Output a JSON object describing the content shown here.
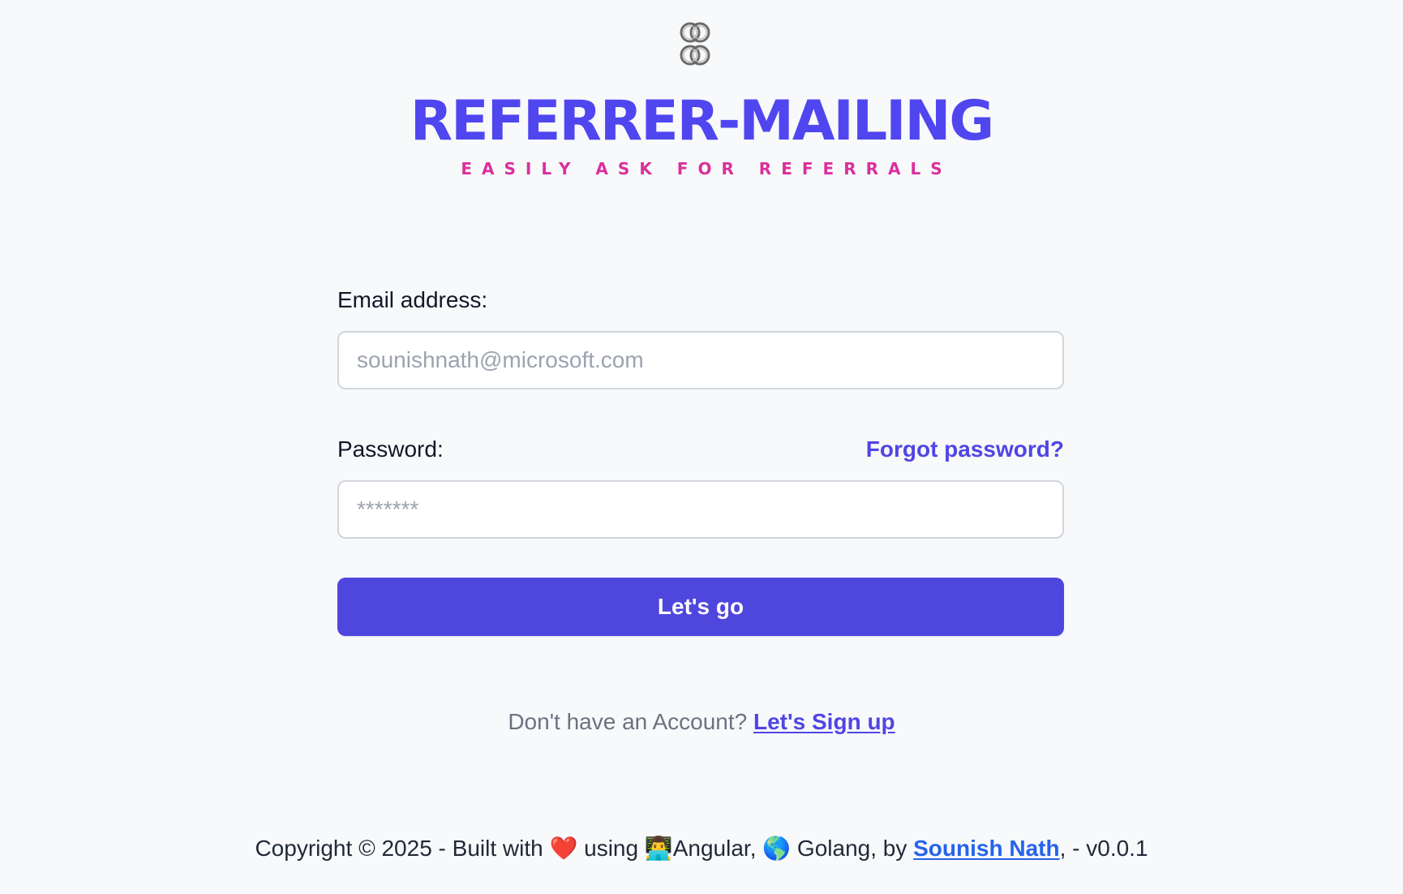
{
  "brand": {
    "logo_icon": "knot-icon",
    "title": "REFERRER-MAILING",
    "tagline": "EASILY ASK FOR REFERRALS",
    "title_color": "#5046ef",
    "tagline_color": "#db2f9c"
  },
  "login_form": {
    "email_label": "Email address:",
    "email_placeholder": "sounishnath@microsoft.com",
    "email_value": "",
    "password_label": "Password:",
    "password_placeholder": "*******",
    "password_value": "",
    "forgot_password": "Forgot password?",
    "submit_label": "Let's go",
    "accent_color": "#4f46e5"
  },
  "signup": {
    "prompt": "Don't have an Account?",
    "link": "Let's Sign up"
  },
  "footer": {
    "copyright": "Copyright © 2025 - Built with",
    "heart_icon": "❤️",
    "using": "using",
    "coder_icon": "👨‍💻",
    "angular": "Angular,",
    "globe_icon": "🌎",
    "golang": "Golang, by",
    "author": "Sounish Nath",
    "separator": ", -",
    "version": "v0.0.1"
  }
}
